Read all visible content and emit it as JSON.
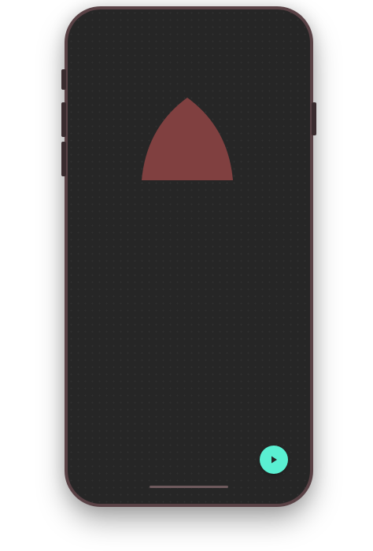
{
  "screen": {
    "background_color": "#262626",
    "shape": {
      "kind": "reuleaux-like arch",
      "color": "#804040"
    },
    "fab": {
      "icon": "play-icon",
      "color": "#5af0d2",
      "icon_color": "#262626"
    }
  },
  "device": {
    "frame_color": "#5a4246"
  }
}
